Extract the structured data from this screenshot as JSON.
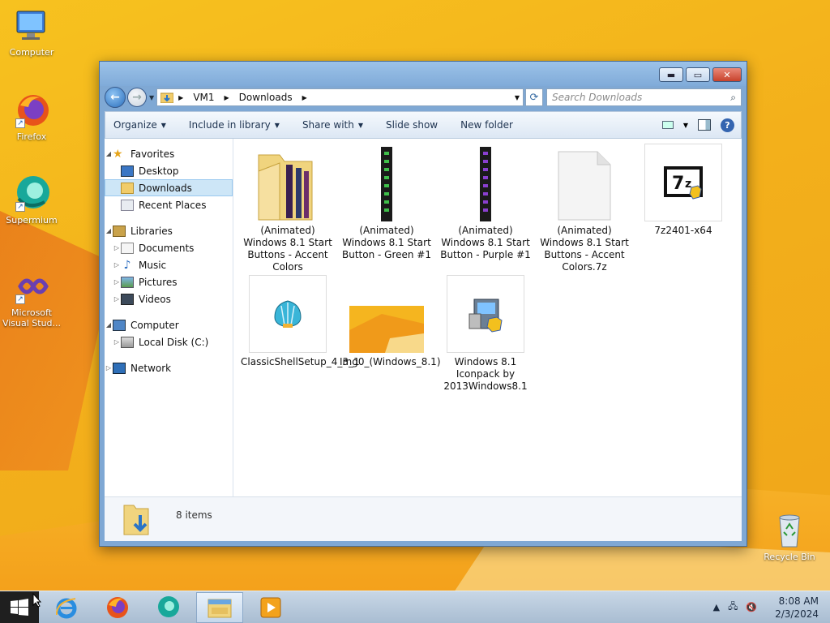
{
  "desktop": {
    "icons": [
      {
        "label": "Computer"
      },
      {
        "label": "Firefox"
      },
      {
        "label": "Supermium"
      },
      {
        "label": "Microsoft Visual Stud..."
      },
      {
        "label": "Recycle Bin"
      }
    ]
  },
  "window": {
    "address": {
      "segments": [
        "VM1",
        "Downloads"
      ]
    },
    "search_placeholder": "Search Downloads",
    "commands": [
      "Organize",
      "Include in library",
      "Share with",
      "Slide show",
      "New folder"
    ],
    "nav_pane": {
      "favorites": {
        "label": "Favorites",
        "items": [
          "Desktop",
          "Downloads",
          "Recent Places"
        ]
      },
      "libraries": {
        "label": "Libraries",
        "items": [
          "Documents",
          "Music",
          "Pictures",
          "Videos"
        ]
      },
      "computer": {
        "label": "Computer",
        "items": [
          "Local Disk (C:)"
        ]
      },
      "network": {
        "label": "Network"
      },
      "selected": "Downloads"
    },
    "files": [
      {
        "name": "(Animated) Windows 8.1 Start Buttons - Accent Colors",
        "icon": "folder-icon"
      },
      {
        "name": "(Animated) Windows 8.1 Start Button - Green #1",
        "icon": "filmstrip-green-icon"
      },
      {
        "name": "(Animated) Windows 8.1 Start Button - Purple #1",
        "icon": "filmstrip-purple-icon"
      },
      {
        "name": "(Animated) Windows 8.1 Start Buttons - Accent Colors.7z",
        "icon": "blank-file-icon"
      },
      {
        "name": "7z2401-x64",
        "icon": "7zip-installer-icon"
      },
      {
        "name": "ClassicShellSetup_4_3_1",
        "icon": "classic-shell-icon"
      },
      {
        "name": "Img0_(Windows_8.1)",
        "icon": "wallpaper-thumbnail"
      },
      {
        "name": "Windows 8.1 Iconpack by 2013Windows8.1",
        "icon": "installer-icon"
      }
    ],
    "status": {
      "count": "8 items"
    }
  },
  "taskbar": {
    "pinned": [
      "internet-explorer-icon",
      "firefox-icon",
      "supermium-icon",
      "file-explorer-icon",
      "media-player-icon"
    ],
    "active": "file-explorer-icon",
    "clock": {
      "time": "8:08 AM",
      "date": "2/3/2024"
    }
  },
  "colors": {
    "desktop_accent": "#f3b01b",
    "selection": "#cde6f7",
    "window_frame": "#7fa8d4"
  }
}
